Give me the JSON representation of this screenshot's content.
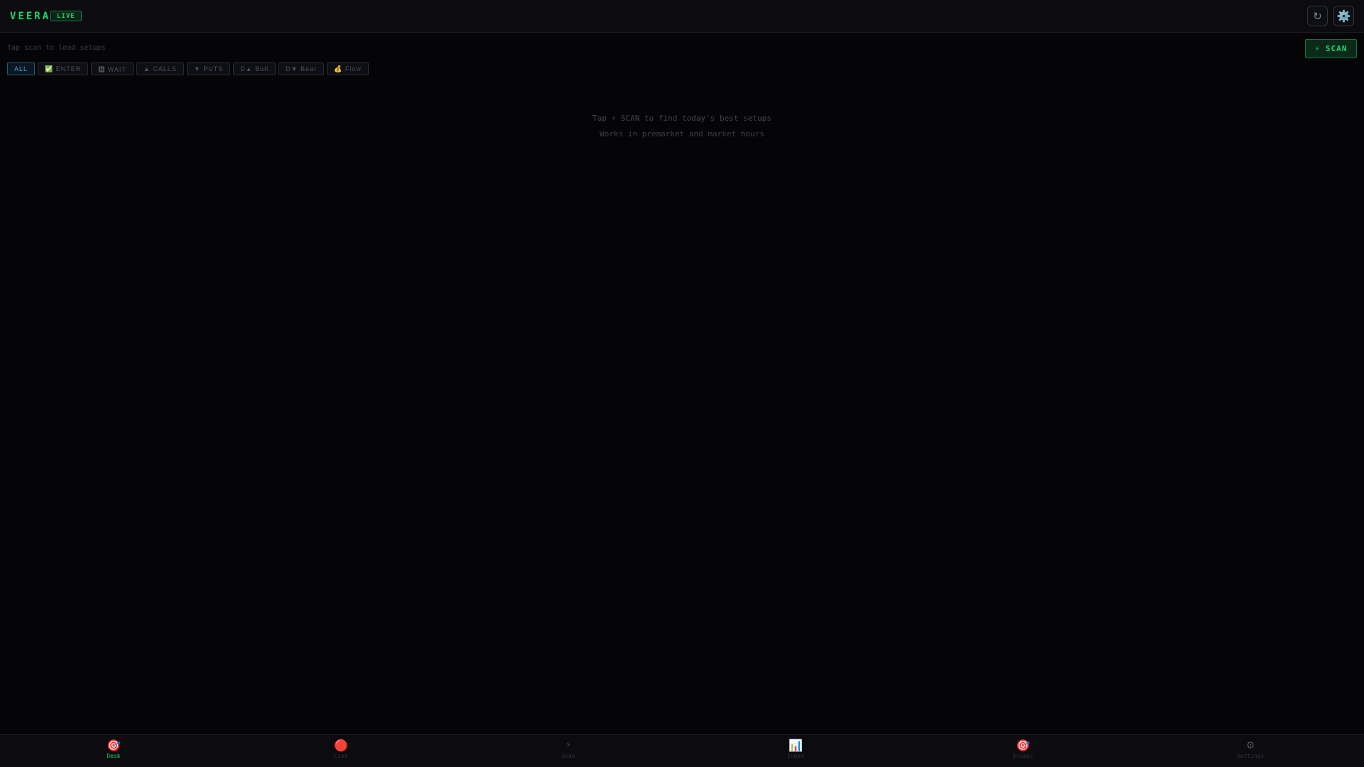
{
  "header": {
    "brand": "VEERA",
    "status_badge": "LIVE",
    "refresh_icon": "↻",
    "settings_icon": "⚙️"
  },
  "toolbar": {
    "subtitle": "Tap scan to load setups",
    "scan_label": "⚡ SCAN"
  },
  "filters": [
    {
      "label": "ALL",
      "active": true
    },
    {
      "label": "✅ ENTER",
      "active": false
    },
    {
      "label": "🅷 WAIT",
      "active": false
    },
    {
      "label": "▲ CALLS",
      "active": false
    },
    {
      "label": "▼ PUTS",
      "active": false
    },
    {
      "label": "D▲ Bull",
      "active": false
    },
    {
      "label": "D▼ Bear",
      "active": false
    },
    {
      "label": "💰 Flow",
      "active": false
    }
  ],
  "empty_state": {
    "line1": "Tap ⚡ SCAN to find today's best setups",
    "line2": "Works in premarket and market hours"
  },
  "nav": [
    {
      "icon": "🎯",
      "label": "Desk",
      "active": true
    },
    {
      "icon": "🔴",
      "label": "Live",
      "active": false
    },
    {
      "icon": "⚡",
      "label": "Scan",
      "active": false
    },
    {
      "icon": "📊",
      "label": "Index",
      "active": false
    },
    {
      "icon": "🎯",
      "label": "Sniper",
      "active": false
    },
    {
      "icon": "⚙",
      "label": "Settings",
      "active": false
    }
  ],
  "colors": {
    "accent_green": "#19d66b",
    "accent_blue": "#38a6e6",
    "background": "#050507"
  }
}
